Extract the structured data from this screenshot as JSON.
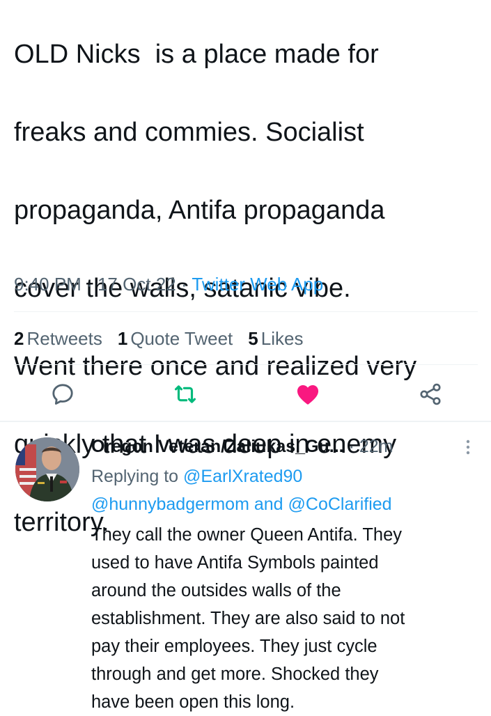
{
  "tweet": {
    "text": "OLD Nicks  is a place made for freaks and commies. Socialist propaganda, Antifa propaganda cover the walls, satanic vibe. Went there once and realized very quickly that I was deep in enemy territory.",
    "line1": "OLD Nicks  is a place made for",
    "line2": "freaks and commies. Socialist",
    "line3": "propaganda, Antifa propaganda",
    "line4": "cover the walls, satanic vibe.",
    "line5": "Went there once and realized very",
    "line6": "quickly that I was deep in enemy",
    "line7": "territory.",
    "time": "9:40 PM",
    "date": "17 Oct 22",
    "sep": "·",
    "app": "Twitter Web App"
  },
  "stats": {
    "retweets_count": "2",
    "retweets_label": "Retweets",
    "quotes_count": "1",
    "quotes_label": "Quote Tweet",
    "likes_count": "5",
    "likes_label": "Likes"
  },
  "actions": {
    "reply_icon": "reply-icon",
    "retweet_icon": "retweet-icon",
    "like_icon": "heart-icon",
    "share_icon": "share-icon",
    "retweet_color": "#00ba7c",
    "like_color": "#f91880"
  },
  "reply": {
    "name": "Oregon Veteran/Zaliukas_Gu...",
    "sep": "·",
    "time": "22m",
    "replying_to_label": "Replying to",
    "mention1": "@EarlXrated90",
    "mention2": "@hunnybadgermom",
    "and_label": "and",
    "mention3": "@CoClarified",
    "line1": "They call the owner Queen Antifa. They",
    "line2": "used to have Antifa Symbols painted",
    "line3": "around the outsides walls of the",
    "line4": "establishment. They are also said to not",
    "line5": "pay their employees. They just cycle",
    "line6": "through and get more. Shocked they",
    "line7": "have been open this long."
  },
  "colors": {
    "link": "#1d9bf0",
    "secondary_text": "#536471",
    "primary_text": "#0f1419"
  }
}
